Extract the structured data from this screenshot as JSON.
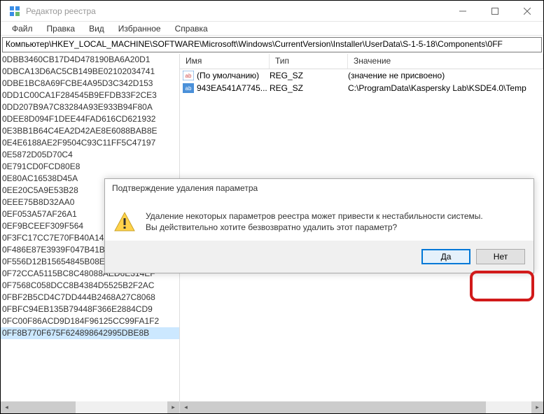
{
  "window": {
    "title": "Редактор реестра"
  },
  "menu": {
    "file": "Файл",
    "edit": "Правка",
    "view": "Вид",
    "favorites": "Избранное",
    "help": "Справка"
  },
  "address": "Компьютер\\HKEY_LOCAL_MACHINE\\SOFTWARE\\Microsoft\\Windows\\CurrentVersion\\Installer\\UserData\\S-1-5-18\\Components\\0FF",
  "tree": [
    "0DBB3460CB17D4D478190BA6A20D1",
    "0DBCA13D6AC5CB149BE02102034741",
    "0DBE1BC8A69FCBE4A95D3C342D153",
    "0DD1C00CA1F284545B9EFDB33F2CE3",
    "0DD207B9A7C83284A93E933B94F80A",
    "0DEE8D094F1DEE44FAD616CD621932",
    "0E3BB1B64C4EA2D42AE8E6088BAB8E",
    "0E4E6188AE2F9504C93C11FF5C47197",
    "0E5872D05D70C4",
    "0E791CD0FCD80E8",
    "0E80AC16538D45A",
    "0EE20C5A9E53B28",
    "0EEE75B8D32AA0",
    "0EF053A57AF26A1",
    "0EF9BCEEF309F564",
    "0F3FC17CC7E70FB40A145D9BDD0D7",
    "0F486E87E3939F047B41B241F867855C",
    "0F556D12B15654845B08EE48431C7D4",
    "0F72CCA5115BC8C48088AED6E314EF",
    "0F7568C058DCC8B4384D5525B2F2AC",
    "0FBF2B5CD4C7DD444B2468A27C8068",
    "0FBFC94EB135B79448F366E2884CD9",
    "0FC00F86ACD9D184F96125CC99FA1F2",
    "0FF8B770F675F624898642995DBE8B"
  ],
  "columns": {
    "name": "Имя",
    "type": "Тип",
    "value": "Значение"
  },
  "values": [
    {
      "name": "(По умолчанию)",
      "type": "REG_SZ",
      "data": "(значение не присвоено)",
      "icon": "default"
    },
    {
      "name": "943EA541A7745...",
      "type": "REG_SZ",
      "data": "C:\\ProgramData\\Kaspersky Lab\\KSDE4.0\\Temp",
      "icon": "string"
    }
  ],
  "dialog": {
    "title": "Подтверждение удаления параметра",
    "line1": "Удаление некоторых параметров реестра может привести к нестабильности системы.",
    "line2": "Вы действительно хотите безвозвратно удалить этот параметр?",
    "yes": "Да",
    "no": "Нет"
  }
}
